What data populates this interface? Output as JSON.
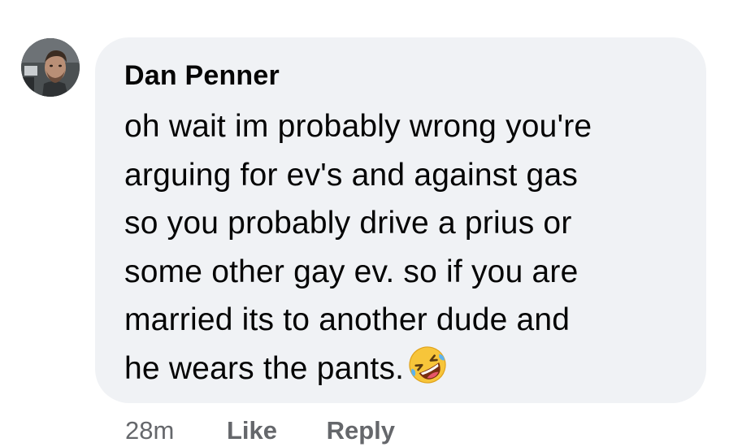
{
  "comment": {
    "author": "Dan Penner",
    "lines": [
      "oh wait im probably wrong you're",
      "arguing for ev's and against gas",
      "so you probably drive a prius or",
      "some other gay ev. so if you are",
      "married its to another dude and",
      "he wears the pants."
    ],
    "emoji": "rolling-on-the-floor-laughing-icon",
    "timestamp": "28m",
    "like_label": "Like",
    "reply_label": "Reply"
  },
  "colors": {
    "bubble_bg": "#f0f2f5",
    "text": "#050505",
    "meta_text": "#65676b"
  }
}
